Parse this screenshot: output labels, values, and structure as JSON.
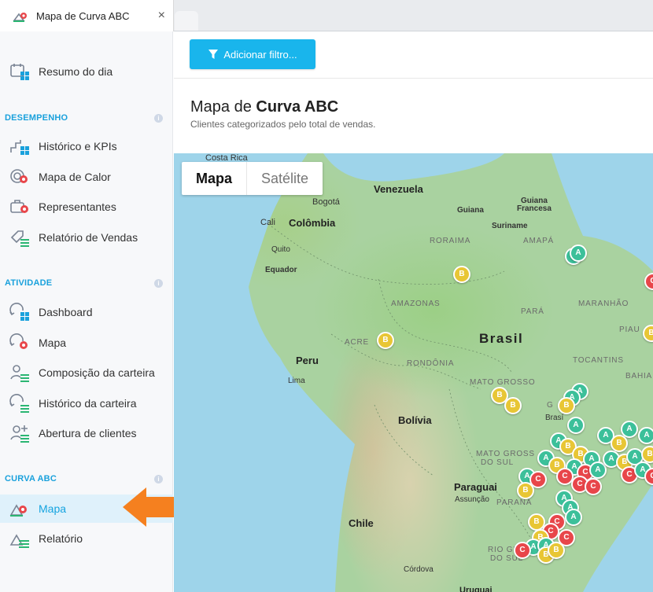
{
  "tab": {
    "title": "Mapa de Curva ABC",
    "close_icon": "×"
  },
  "colors": {
    "accent": "#19b5ec",
    "section": "#1aa1dc",
    "pin_a": "#3cc09a",
    "pin_b": "#e8c635",
    "pin_c": "#e8464a",
    "arrow": "#f5801f"
  },
  "sidebar": {
    "top_item": "Resumo do dia",
    "sections": [
      {
        "title": "DESEMPENHO",
        "items": [
          "Histórico e KPIs",
          "Mapa de Calor",
          "Representantes",
          "Relatório de Vendas"
        ]
      },
      {
        "title": "ATIVIDADE",
        "items": [
          "Dashboard",
          "Mapa",
          "Composição da carteira",
          "Histórico da carteira",
          "Abertura de clientes"
        ]
      },
      {
        "title": "CURVA ABC",
        "items": [
          "Mapa",
          "Relatório"
        ]
      }
    ],
    "info_glyph": "i"
  },
  "toolbar": {
    "filter_label": "Adicionar filtro..."
  },
  "page": {
    "title_prefix": "Mapa de ",
    "title_bold": "Curva ABC",
    "subtitle": "Clientes categorizados pelo total de vendas."
  },
  "map": {
    "toggle": {
      "map": "Mapa",
      "satellite": "Satélite"
    },
    "labels": {
      "costa_rica": "Costa Rica",
      "venezuela": "Venezuela",
      "bogota": "Bogotá",
      "cali": "Cali",
      "colombia": "Colômbia",
      "guiana": "Guiana",
      "guiana_francesa_1": "Guiana",
      "guiana_francesa_2": "Francesa",
      "suriname": "Suriname",
      "roraima": "RORAIMA",
      "amapa": "AMAPÁ",
      "quito": "Quito",
      "equador": "Equador",
      "amazonas": "AMAZONAS",
      "para": "PARÁ",
      "maranhao": "MARANHÃO",
      "piaui": "PIAU",
      "brasil": "Brasil",
      "acre": "ACRE",
      "rondonia": "RONDÔNIA",
      "tocantins": "TOCANTINS",
      "bahia": "BAHIA",
      "peru": "Peru",
      "lima": "Lima",
      "mato_grosso": "MATO GROSSO",
      "bolivia": "Bolívia",
      "brasilia": "Brasí",
      "goias": "G",
      "ms_1": "MATO GROSS",
      "ms_2": "DO SUL",
      "paraguai": "Paraguai",
      "assuncao": "Assunção",
      "parana": "PARANÁ",
      "chile": "Chile",
      "rs_1": "RIO GR",
      "rs_2": "DO SUL",
      "cordova": "Córdova",
      "uruguai": "Uruguai"
    }
  }
}
